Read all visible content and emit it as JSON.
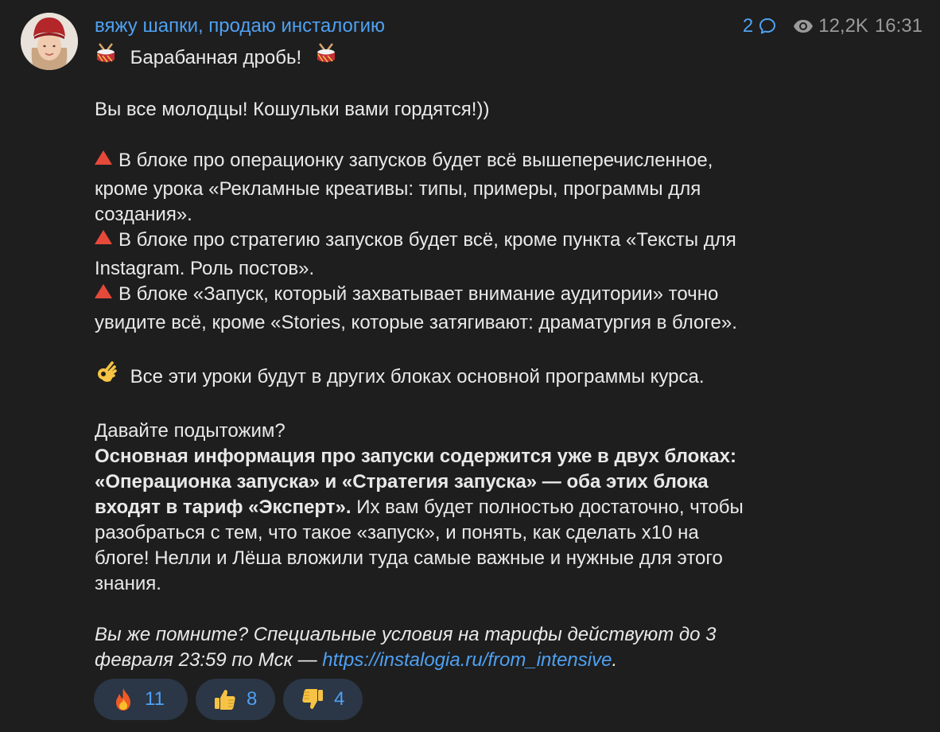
{
  "channel": {
    "name": "вяжу шапки, продаю инсталогию"
  },
  "meta": {
    "comments_count": "2",
    "views": "12,2K",
    "time": "16:31"
  },
  "post": {
    "line1": "Барабанная дробь!",
    "line2": "Вы все молодцы! Кошульки вами гордятся!))",
    "b1_l1": "В блоке про операционку запусков будет всё вышеперечисленное,",
    "b1_l2": "кроме урока «Рекламные креативы: типы, примеры, программы для",
    "b1_l3": "создания».",
    "b2_l1": "В блоке про стратегию запусков будет всё, кроме пункта «Тексты для",
    "b2_l2": "Instagram. Роль постов».",
    "b3_l1": "В блоке «Запуск, который захватывает внимание аудитории» точно",
    "b3_l2": "увидите всё, кроме «Stories, которые затягивают: драматургия в блоге».",
    "ok_line": "Все эти уроки будут в других блоках основной программы курса.",
    "sum_q": "Давайте подытожим?",
    "sum_b1": "Основная информация про запуски содержится уже в двух блоках:",
    "sum_b2": "«Операционка запуска» и «Стратегия запуска» — оба этих блока",
    "sum_b3_bold": "входят в тариф «Эксперт».",
    "sum_b3_rest": " Их вам будет полностью достаточно, чтобы",
    "sum_l4": "разобраться с тем, что такое «запуск», и понять, как сделать х10 на",
    "sum_l5": "блоге! Нелли и Лёша вложили туда самые важные и нужные для этого",
    "sum_l6": "знания.",
    "final_l1": "Вы же помните? Специальные условия на тарифы действуют до 3",
    "final_l2": "февраля 23:59 по Мск  — ",
    "link": "https://instalogia.ru/from_intensive",
    "final_end": "."
  },
  "reactions": [
    {
      "icon": "fire-icon",
      "count": "11"
    },
    {
      "icon": "thumbs-up-icon",
      "count": "8"
    },
    {
      "icon": "thumbs-down-icon",
      "count": "4"
    }
  ],
  "colors": {
    "background": "#1e1e1e",
    "accent": "#4ea1f3",
    "text": "#e9e9e9",
    "meta": "#9a9a9a",
    "reaction_bg": "#2b3646",
    "triangle": "#e5493a"
  }
}
